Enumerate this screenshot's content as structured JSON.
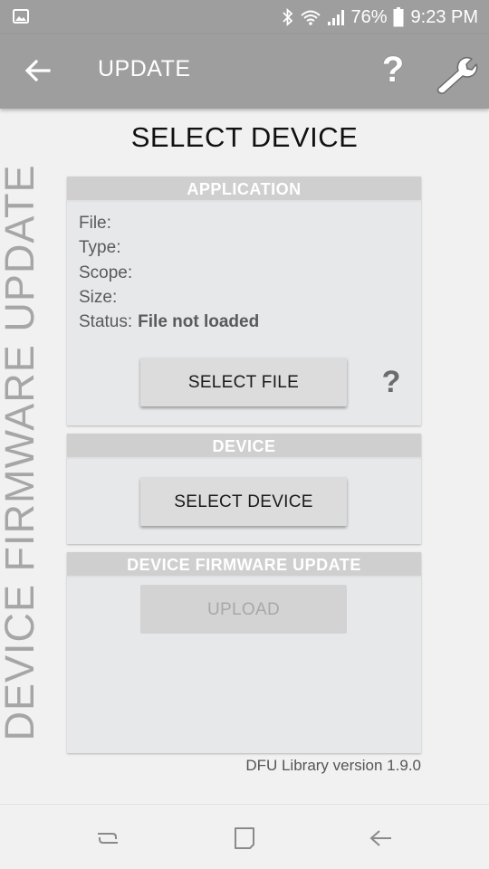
{
  "status_bar": {
    "battery_percent": "76%",
    "time": "9:23 PM",
    "icons": [
      "image-icon",
      "bluetooth-icon",
      "wifi-icon",
      "signal-icon",
      "battery-icon"
    ]
  },
  "app_bar": {
    "title": "UPDATE",
    "help_glyph": "?",
    "icons": [
      "back-arrow-icon",
      "help-icon",
      "wrench-icon"
    ]
  },
  "page": {
    "title": "SELECT DEVICE",
    "vertical_label": "DEVICE FIRMWARE UPDATE"
  },
  "application_panel": {
    "header": "APPLICATION",
    "file_label": "File:",
    "type_label": "Type:",
    "scope_label": "Scope:",
    "size_label": "Size:",
    "status_label": "Status:",
    "status_value": "File not loaded",
    "select_file_label": "SELECT FILE",
    "help_glyph": "?"
  },
  "device_panel": {
    "header": "DEVICE",
    "select_device_label": "SELECT DEVICE"
  },
  "dfu_panel": {
    "header": "DEVICE FIRMWARE UPDATE",
    "upload_label": "UPLOAD",
    "upload_enabled": false
  },
  "footer": {
    "library_version": "DFU Library version 1.9.0"
  },
  "nav_bar": {
    "icons": [
      "recent-apps-icon",
      "home-icon",
      "back-icon"
    ]
  },
  "colors": {
    "app_bar": "#9e9e9e",
    "panel": "#e7e8ea",
    "panel_header": "#cfcfcf",
    "background": "#f1f1f1"
  }
}
